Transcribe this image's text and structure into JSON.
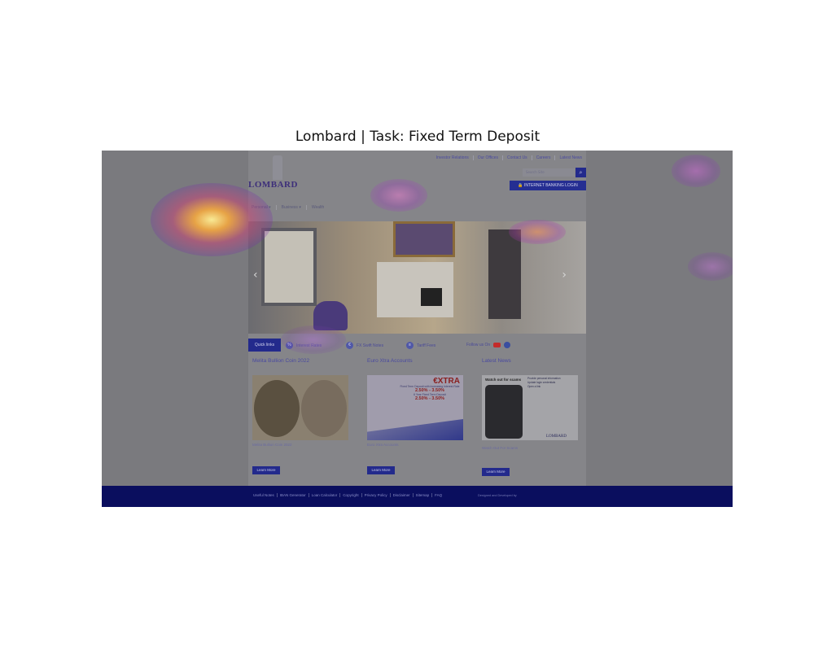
{
  "figure": {
    "title": "Lombard | Task: Fixed Term Deposit"
  },
  "topnav": [
    "Investor Relations",
    "Our Offices",
    "Contact Us",
    "Careers",
    "Latest News"
  ],
  "brand": {
    "name": "LOMBARD"
  },
  "search": {
    "placeholder": "Search Site"
  },
  "internet_banking": {
    "label": "🔒 INTERNET BANKING LOGIN"
  },
  "mainnav": [
    "Personal ▾",
    "Business ▾",
    "Wealth"
  ],
  "quick_links": {
    "label": "Quick links",
    "items": [
      "Interest Rates",
      "FX Swift Notes",
      "Tariff Fees"
    ],
    "follow": "Follow us On"
  },
  "cards": [
    {
      "title": "Melita Bullion Coin 2022",
      "caption": "Melita Bullion Coin 2022",
      "button": "Learn More"
    },
    {
      "title": "Euro Xtra Accounts",
      "caption": "Euro Xtra Accounts",
      "button": "Learn More",
      "promo": {
        "brand": "€XTRA",
        "line1": "Fixed Term Deposit with Increasing Interest Rate",
        "rate1": "2.50% - 3.50%",
        "line2": "6 Year Fixed Term Deposit",
        "rate2": "2.50% - 3.50%"
      }
    },
    {
      "title": "Latest News",
      "caption": "Watch Out For Scams",
      "button": "Learn More",
      "promo": {
        "heading": "Watch out for scams",
        "points": [
          "Provide personal information",
          "Update login credentials",
          "Open a link"
        ],
        "brand": "LOMBARD"
      }
    }
  ],
  "footer": {
    "links": [
      "Useful Notes",
      "IBAN Generator",
      "Loan Calculator",
      "Copyright",
      "Privacy Policy",
      "Disclaimer",
      "Sitemap",
      "FAQ"
    ],
    "credit": "Designed and Developed by"
  }
}
